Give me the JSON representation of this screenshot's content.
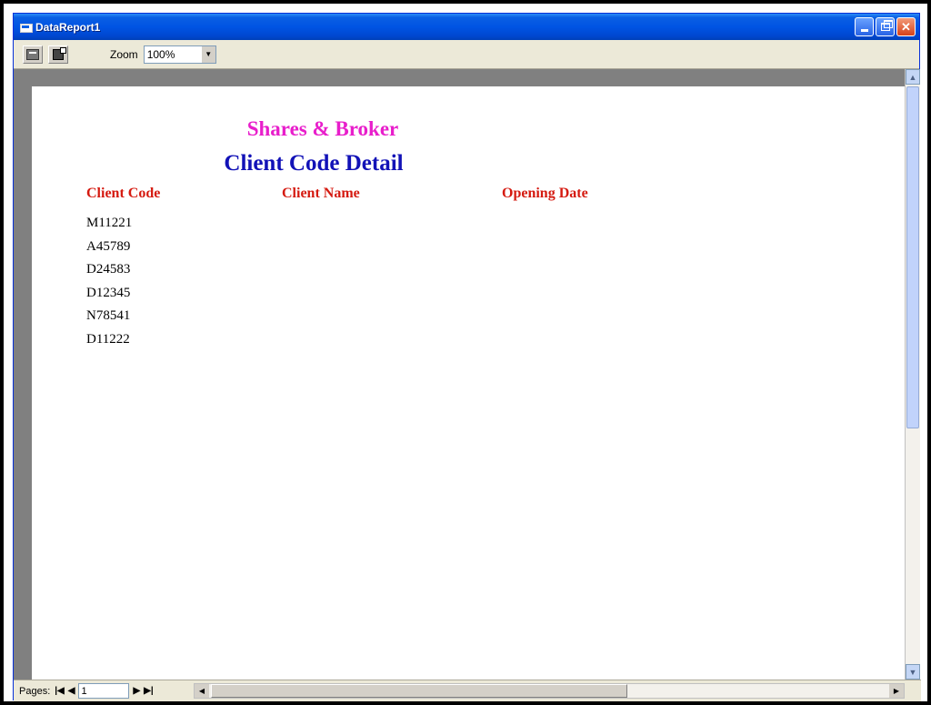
{
  "window": {
    "title": "DataReport1",
    "minimize_icon": "minimize-icon",
    "restore_icon": "restore-icon",
    "close_icon": "close-icon"
  },
  "toolbar": {
    "print_icon": "printer-icon",
    "export_icon": "export-icon",
    "zoom_label": "Zoom",
    "zoom_value": "100%"
  },
  "report": {
    "title": "Shares & Broker",
    "subtitle": "Client Code Detail",
    "columns": [
      "Client Code",
      "Client Name",
      "Opening Date"
    ],
    "rows": [
      "M11221",
      "A45789",
      "D24583",
      "D12345",
      "N78541",
      "D11222"
    ],
    "colors": {
      "title": "#e81ecb",
      "subtitle": "#1212b7",
      "header": "#d51a10"
    }
  },
  "statusbar": {
    "pages_label": "Pages:",
    "current_page": "1"
  }
}
